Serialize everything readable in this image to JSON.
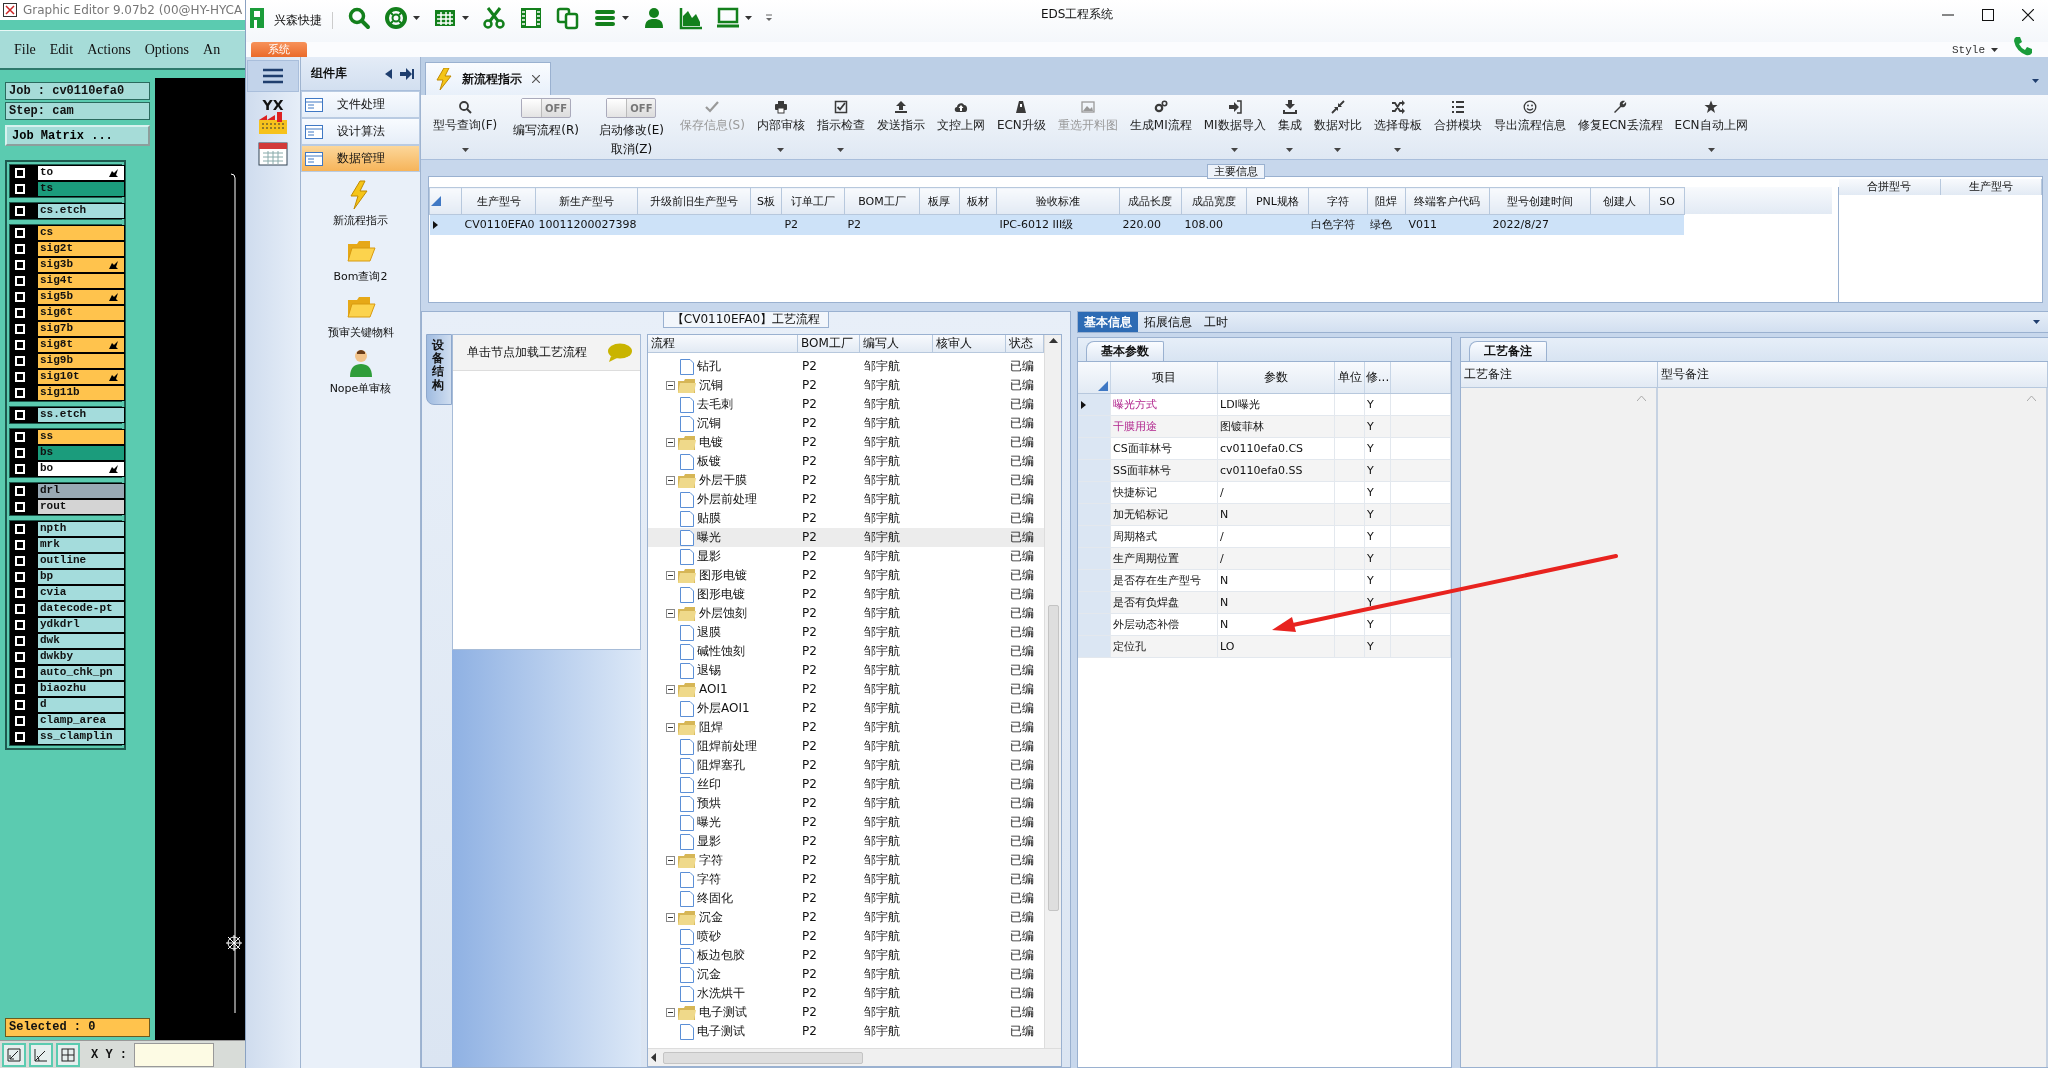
{
  "graphic_editor": {
    "title": "Graphic Editor 9.07b2 (00@HY-HYCA",
    "menu": [
      "File",
      "Edit",
      "Actions",
      "Options",
      "An"
    ],
    "job": "Job : cv0110efa0",
    "step": "Step: cam",
    "job_matrix_button": "Job Matrix ...",
    "layer_groups": [
      {
        "layers": [
          {
            "name": "to",
            "color": "#ffffff",
            "checked": false,
            "marked": true
          },
          {
            "name": "ts",
            "color": "#1b9c7c",
            "checked": false,
            "marked": false
          }
        ]
      },
      {
        "layers": [
          {
            "name": "cs.etch",
            "color": "#a4dcdc",
            "checked": false,
            "marked": false
          }
        ]
      },
      {
        "layers": [
          {
            "name": "cs",
            "color": "#ffc34d",
            "checked": false,
            "marked": false
          },
          {
            "name": "sig2t",
            "color": "#ffc34d",
            "checked": false,
            "marked": false
          },
          {
            "name": "sig3b",
            "color": "#ffc34d",
            "checked": false,
            "marked": true
          },
          {
            "name": "sig4t",
            "color": "#ffc34d",
            "checked": false,
            "marked": false
          },
          {
            "name": "sig5b",
            "color": "#ffc34d",
            "checked": false,
            "marked": true
          },
          {
            "name": "sig6t",
            "color": "#ffc34d",
            "checked": false,
            "marked": false
          },
          {
            "name": "sig7b",
            "color": "#ffc34d",
            "checked": false,
            "marked": false
          },
          {
            "name": "sig8t",
            "color": "#ffc34d",
            "checked": false,
            "marked": true
          },
          {
            "name": "sig9b",
            "color": "#ffc34d",
            "checked": false,
            "marked": false
          },
          {
            "name": "sig10t",
            "color": "#ffc34d",
            "checked": false,
            "marked": true
          },
          {
            "name": "sig11b",
            "color": "#ffc34d",
            "checked": false,
            "marked": false
          }
        ]
      },
      {
        "layers": [
          {
            "name": "ss.etch",
            "color": "#a4dcdc",
            "checked": false,
            "marked": false
          }
        ]
      },
      {
        "layers": [
          {
            "name": "ss",
            "color": "#ffc34d",
            "checked": false,
            "marked": false
          },
          {
            "name": "bs",
            "color": "#1b9c7c",
            "checked": false,
            "marked": false
          },
          {
            "name": "bo",
            "color": "#ffffff",
            "checked": false,
            "marked": true
          }
        ]
      },
      {
        "layers": [
          {
            "name": "drl",
            "color": "#98a9b4",
            "checked": false,
            "marked": false
          },
          {
            "name": "rout",
            "color": "#d4d4d4",
            "checked": false,
            "marked": false
          }
        ]
      },
      {
        "layers": [
          {
            "name": "npth",
            "color": "#a4dcdc",
            "checked": false,
            "marked": false
          },
          {
            "name": "mrk",
            "color": "#a4dcdc",
            "checked": false,
            "marked": false
          },
          {
            "name": "outline",
            "color": "#a4dcdc",
            "checked": false,
            "marked": false
          },
          {
            "name": "bp",
            "color": "#a4dcdc",
            "checked": false,
            "marked": false
          },
          {
            "name": "cvia",
            "color": "#a4dcdc",
            "checked": false,
            "marked": false
          },
          {
            "name": "datecode-pt",
            "color": "#a4dcdc",
            "checked": false,
            "marked": false
          },
          {
            "name": "ydkdrl",
            "color": "#a4dcdc",
            "checked": false,
            "marked": false
          },
          {
            "name": "dwk",
            "color": "#a4dcdc",
            "checked": false,
            "marked": false
          },
          {
            "name": "dwkby",
            "color": "#a4dcdc",
            "checked": false,
            "marked": false
          },
          {
            "name": "auto_chk_pn",
            "color": "#a4dcdc",
            "checked": false,
            "marked": false
          },
          {
            "name": "biaozhu",
            "color": "#a4dcdc",
            "checked": false,
            "marked": false
          },
          {
            "name": "d",
            "color": "#a4dcdc",
            "checked": false,
            "marked": false
          },
          {
            "name": "clamp_area",
            "color": "#a4dcdc",
            "checked": false,
            "marked": false
          },
          {
            "name": "ss_clamplin",
            "color": "#a4dcdc",
            "checked": false,
            "marked": false
          }
        ]
      }
    ],
    "selected_status": "Selected : 0",
    "xy_label": "X Y :"
  },
  "eds": {
    "brand": "兴森快捷",
    "title": "EDS工程系统",
    "system_tab": "系统",
    "style_menu": "Style",
    "nav_logo_text": "YX",
    "component_library": {
      "title": "组件库",
      "items": [
        {
          "label": "文件处理",
          "selected": false
        },
        {
          "label": "设计算法",
          "selected": false
        },
        {
          "label": "数据管理",
          "selected": true
        }
      ],
      "tools": [
        {
          "label": "新流程指示"
        },
        {
          "label": "Bom查询2"
        },
        {
          "label": "预审关键物料"
        },
        {
          "label": "Nope单审核"
        }
      ]
    },
    "doc_tabs": [
      {
        "label": "新流程指示",
        "selected": true
      }
    ],
    "ribbon": [
      {
        "kind": "button",
        "label": "型号查询(F)",
        "disabled": false,
        "dropdown": true
      },
      {
        "kind": "toggle",
        "label": "编写流程(R)",
        "switch_text": "OFF",
        "on": false
      },
      {
        "kind": "toggle",
        "label": "启动修改(E)",
        "sublabel": "取消(Z)",
        "switch_text": "OFF",
        "on": false
      },
      {
        "kind": "button",
        "label": "保存信息(S)",
        "disabled": true,
        "dropdown": false
      },
      {
        "kind": "button",
        "label": "内部审核",
        "disabled": false,
        "dropdown": true
      },
      {
        "kind": "button",
        "label": "指示检查",
        "disabled": false,
        "dropdown": true
      },
      {
        "kind": "button",
        "label": "发送指示",
        "disabled": false,
        "dropdown": false
      },
      {
        "kind": "button",
        "label": "文控上网",
        "disabled": false,
        "dropdown": false
      },
      {
        "kind": "button",
        "label": "ECN升级",
        "disabled": false,
        "dropdown": false
      },
      {
        "kind": "button",
        "label": "重选开料图",
        "disabled": true,
        "dropdown": false
      },
      {
        "kind": "button",
        "label": "生成MI流程",
        "disabled": false,
        "dropdown": false
      },
      {
        "kind": "button",
        "label": "MI数据导入",
        "disabled": false,
        "dropdown": true
      },
      {
        "kind": "button",
        "label": "集成",
        "disabled": false,
        "dropdown": true
      },
      {
        "kind": "button",
        "label": "数据对比",
        "disabled": false,
        "dropdown": true
      },
      {
        "kind": "button",
        "label": "选择母板",
        "disabled": false,
        "dropdown": true
      },
      {
        "kind": "button",
        "label": "合拼模块",
        "disabled": false,
        "dropdown": false
      },
      {
        "kind": "button",
        "label": "导出流程信息",
        "disabled": false,
        "dropdown": false
      },
      {
        "kind": "button",
        "label": "修复ECN丢流程",
        "disabled": false,
        "dropdown": false
      },
      {
        "kind": "button",
        "label": "ECN自动上网",
        "disabled": false,
        "dropdown": true
      }
    ],
    "main_info": {
      "title": "主要信息",
      "row_selected": true,
      "columns": [
        {
          "label": "生产型号",
          "value": "CV0110EFA0"
        },
        {
          "label": "新生产型号",
          "value": "10011200027398"
        },
        {
          "label": "升级前旧生产型号"
        },
        {
          "label": "S板"
        },
        {
          "label": "订单工厂",
          "value": "P2"
        },
        {
          "label": "BOM工厂",
          "value": "P2"
        },
        {
          "label": "板厚"
        },
        {
          "label": "板材"
        },
        {
          "label": "验收标准",
          "value": "IPC-6012 III级"
        },
        {
          "label": "成品长度",
          "value": "220.00"
        },
        {
          "label": "成品宽度",
          "value": "108.00"
        },
        {
          "label": "PNL规格"
        },
        {
          "label": "字符",
          "value": "白色字符"
        },
        {
          "label": "阻焊",
          "value": "绿色"
        },
        {
          "label": "终端客户代码",
          "value": "V011"
        },
        {
          "label": "型号创建时间",
          "value": "2022/8/27"
        },
        {
          "label": "创建人"
        },
        {
          "label": "SO"
        }
      ],
      "side_columns": [
        "合拼型号",
        "生产型号"
      ]
    },
    "process": {
      "title": "【CV0110EFA0】工艺流程",
      "side_tab": "设备结构",
      "hint": "单击节点加载工艺流程",
      "columns": [
        "流程",
        "BOM工厂",
        "编写人",
        "核审人",
        "状态"
      ],
      "tree": [
        {
          "children": [
            {
              "name": "钻孔",
              "bom": "P2",
              "author": "邹宇航",
              "status": "已编",
              "selected": false
            }
          ]
        },
        {
          "name": "沉铜",
          "bom": "P2",
          "author": "邹宇航",
          "status": "已编",
          "selected": false,
          "expanded": true,
          "children": [
            {
              "name": "去毛刺",
              "bom": "P2",
              "author": "邹宇航",
              "status": "已编",
              "selected": false
            },
            {
              "name": "沉铜",
              "bom": "P2",
              "author": "邹宇航",
              "status": "已编",
              "selected": false
            }
          ]
        },
        {
          "name": "电镀",
          "bom": "P2",
          "author": "邹宇航",
          "status": "已编",
          "selected": false,
          "expanded": true,
          "children": [
            {
              "name": "板镀",
              "bom": "P2",
              "author": "邹宇航",
              "status": "已编",
              "selected": false
            }
          ]
        },
        {
          "name": "外层干膜",
          "bom": "P2",
          "author": "邹宇航",
          "status": "已编",
          "selected": false,
          "expanded": true,
          "children": [
            {
              "name": "外层前处理",
              "bom": "P2",
              "author": "邹宇航",
              "status": "已编",
              "selected": false
            },
            {
              "name": "贴膜",
              "bom": "P2",
              "author": "邹宇航",
              "status": "已编",
              "selected": false
            },
            {
              "name": "曝光",
              "bom": "P2",
              "author": "邹宇航",
              "status": "已编",
              "selected": true
            },
            {
              "name": "显影",
              "bom": "P2",
              "author": "邹宇航",
              "status": "已编",
              "selected": false
            }
          ]
        },
        {
          "name": "图形电镀",
          "bom": "P2",
          "author": "邹宇航",
          "status": "已编",
          "selected": false,
          "expanded": true,
          "children": [
            {
              "name": "图形电镀",
              "bom": "P2",
              "author": "邹宇航",
              "status": "已编",
              "selected": false
            }
          ]
        },
        {
          "name": "外层蚀刻",
          "bom": "P2",
          "author": "邹宇航",
          "status": "已编",
          "selected": false,
          "expanded": true,
          "children": [
            {
              "name": "退膜",
              "bom": "P2",
              "author": "邹宇航",
              "status": "已编",
              "selected": false
            },
            {
              "name": "碱性蚀刻",
              "bom": "P2",
              "author": "邹宇航",
              "status": "已编",
              "selected": false
            },
            {
              "name": "退锡",
              "bom": "P2",
              "author": "邹宇航",
              "status": "已编",
              "selected": false
            }
          ]
        },
        {
          "name": "AOI1",
          "bom": "P2",
          "author": "邹宇航",
          "status": "已编",
          "selected": false,
          "expanded": true,
          "children": [
            {
              "name": "外层AOI1",
              "bom": "P2",
              "author": "邹宇航",
              "status": "已编",
              "selected": false
            }
          ]
        },
        {
          "name": "阻焊",
          "bom": "P2",
          "author": "邹宇航",
          "status": "已编",
          "selected": false,
          "expanded": true,
          "children": [
            {
              "name": "阻焊前处理",
              "bom": "P2",
              "author": "邹宇航",
              "status": "已编",
              "selected": false
            },
            {
              "name": "阻焊塞孔",
              "bom": "P2",
              "author": "邹宇航",
              "status": "已编",
              "selected": false
            },
            {
              "name": "丝印",
              "bom": "P2",
              "author": "邹宇航",
              "status": "已编",
              "selected": false
            },
            {
              "name": "预烘",
              "bom": "P2",
              "author": "邹宇航",
              "status": "已编",
              "selected": false
            },
            {
              "name": "曝光",
              "bom": "P2",
              "author": "邹宇航",
              "status": "已编",
              "selected": false
            },
            {
              "name": "显影",
              "bom": "P2",
              "author": "邹宇航",
              "status": "已编",
              "selected": false
            }
          ]
        },
        {
          "name": "字符",
          "bom": "P2",
          "author": "邹宇航",
          "status": "已编",
          "selected": false,
          "expanded": true,
          "children": [
            {
              "name": "字符",
              "bom": "P2",
              "author": "邹宇航",
              "status": "已编",
              "selected": false
            },
            {
              "name": "终固化",
              "bom": "P2",
              "author": "邹宇航",
              "status": "已编",
              "selected": false
            }
          ]
        },
        {
          "name": "沉金",
          "bom": "P2",
          "author": "邹宇航",
          "status": "已编",
          "selected": false,
          "expanded": true,
          "children": [
            {
              "name": "喷砂",
              "bom": "P2",
              "author": "邹宇航",
              "status": "已编",
              "selected": false
            },
            {
              "name": "板边包胶",
              "bom": "P2",
              "author": "邹宇航",
              "status": "已编",
              "selected": false
            },
            {
              "name": "沉金",
              "bom": "P2",
              "author": "邹宇航",
              "status": "已编",
              "selected": false
            },
            {
              "name": "水洗烘干",
              "bom": "P2",
              "author": "邹宇航",
              "status": "已编",
              "selected": false
            }
          ]
        },
        {
          "name": "电子测试",
          "bom": "P2",
          "author": "邹宇航",
          "status": "已编",
          "selected": false,
          "expanded": true,
          "children": [
            {
              "name": "电子测试",
              "bom": "P2",
              "author": "邹宇航",
              "status": "已编",
              "selected": false
            }
          ]
        }
      ]
    },
    "details": {
      "tabs": [
        {
          "label": "基本信息",
          "selected": true
        },
        {
          "label": "拓展信息",
          "selected": false
        },
        {
          "label": "工时",
          "selected": false
        }
      ],
      "params_tab": "基本参数",
      "param_columns": [
        "项目",
        "参数",
        "单位",
        "修..."
      ],
      "params": [
        {
          "item": "曝光方式",
          "value": "LDI曝光",
          "modify": "Y",
          "required": true,
          "current": true
        },
        {
          "item": "干膜用途",
          "value": "图镀菲林",
          "modify": "Y",
          "required": true,
          "current": false
        },
        {
          "item": "CS面菲林号",
          "value": "cv0110efa0.CS",
          "modify": "Y",
          "required": false,
          "current": false
        },
        {
          "item": "SS面菲林号",
          "value": "cv0110efa0.SS",
          "modify": "Y",
          "required": false,
          "current": false
        },
        {
          "item": "快捷标记",
          "value": "/",
          "modify": "Y",
          "required": false,
          "current": false
        },
        {
          "item": "加无铅标记",
          "value": "N",
          "modify": "Y",
          "required": false,
          "current": false
        },
        {
          "item": "周期格式",
          "value": "/",
          "modify": "Y",
          "required": false,
          "current": false
        },
        {
          "item": "生产周期位置",
          "value": "/",
          "modify": "Y",
          "required": false,
          "current": false
        },
        {
          "item": "是否存在生产型号",
          "value": "N",
          "modify": "Y",
          "required": false,
          "current": false
        },
        {
          "item": "是否有负焊盘",
          "value": "N",
          "modify": "Y",
          "required": false,
          "current": false
        },
        {
          "item": "外层动态补偿",
          "value": "N",
          "modify": "Y",
          "required": false,
          "current": false
        },
        {
          "item": "定位孔",
          "value": "LO",
          "modify": "Y",
          "required": false,
          "current": false
        }
      ],
      "notes_tab": "工艺备注",
      "notes_columns": [
        "工艺备注",
        "型号备注"
      ]
    }
  }
}
